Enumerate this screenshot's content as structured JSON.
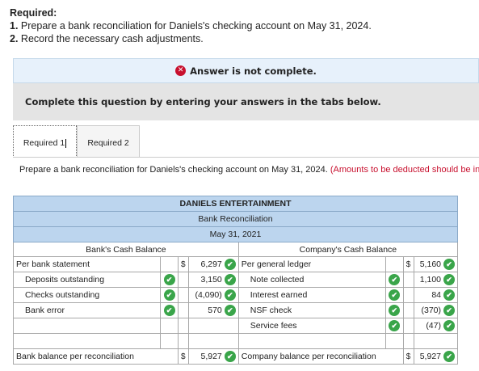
{
  "requirements": {
    "heading": "Required:",
    "items": [
      {
        "num": "1.",
        "text": "Prepare a bank reconciliation for Daniels's checking account on May 31, 2024."
      },
      {
        "num": "2.",
        "text": "Record the necessary cash adjustments."
      }
    ]
  },
  "status": {
    "icon": "x-circle-icon",
    "text": "Answer is not complete.",
    "color": "#c8102e"
  },
  "instruction": "Complete this question by entering your answers in the tabs below.",
  "tabs": [
    {
      "label": "Required 1",
      "active": true
    },
    {
      "label": "Required 2",
      "active": false
    }
  ],
  "panel": {
    "prompt": "Prepare a bank reconciliation for Daniels's checking account on May 31, 2024.",
    "note": "(Amounts to be deducted should be indicated with a minus sign. Total entries to the same account together when entering in the bank reconciliation.)"
  },
  "reconciliation": {
    "company": "DANIELS ENTERTAINMENT",
    "title": "Bank Reconciliation",
    "date": "May 31, 2021",
    "bank_header": "Bank's Cash Balance",
    "company_header": "Company's Cash Balance",
    "bank_rows": [
      {
        "label": "Per bank statement",
        "dollar": "$",
        "amount": "6,297",
        "check": true,
        "checkbox": false
      },
      {
        "label": "Deposits outstanding",
        "dollar": "",
        "amount": "3,150",
        "check": true,
        "checkbox": true
      },
      {
        "label": "Checks outstanding",
        "dollar": "",
        "amount": "(4,090)",
        "check": true,
        "checkbox": true
      },
      {
        "label": "Bank error",
        "dollar": "",
        "amount": "570",
        "check": true,
        "checkbox": true
      },
      {
        "label": "",
        "dollar": "",
        "amount": "",
        "check": false,
        "checkbox": false
      }
    ],
    "company_rows": [
      {
        "label": "Per general ledger",
        "dollar": "$",
        "amount": "5,160",
        "check": true,
        "checkbox": false
      },
      {
        "label": "Note collected",
        "dollar": "",
        "amount": "1,100",
        "check": true,
        "checkbox": true
      },
      {
        "label": "Interest earned",
        "dollar": "",
        "amount": "84",
        "check": true,
        "checkbox": true
      },
      {
        "label": "NSF check",
        "dollar": "",
        "amount": "(370)",
        "check": true,
        "checkbox": true
      },
      {
        "label": "Service fees",
        "dollar": "",
        "amount": "(47)",
        "check": true,
        "checkbox": true
      }
    ],
    "bank_total": {
      "label": "Bank balance per reconciliation",
      "dollar": "$",
      "amount": "5,927"
    },
    "company_total": {
      "label": "Company balance per reconciliation",
      "dollar": "$",
      "amount": "5,927"
    },
    "check_color": "#3aa54a",
    "header_color": "#bcd5ee"
  }
}
